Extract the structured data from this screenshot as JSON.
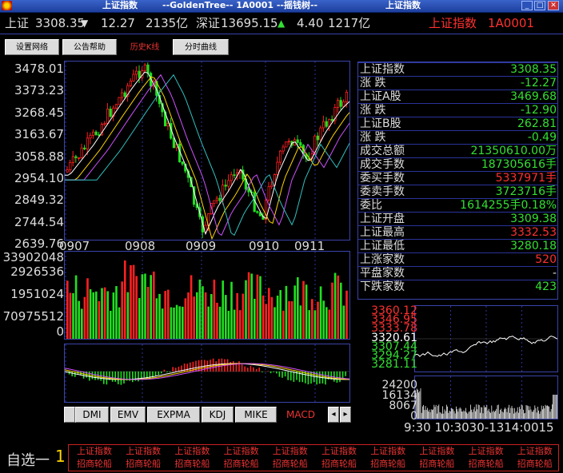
{
  "window": {
    "title_left": "上证指数",
    "title_mid": "--GoldenTree--   1A0001   --摇钱树--",
    "title_right": "上证指数"
  },
  "ticker": {
    "sh_label": "上证",
    "sh_value": "3308.35",
    "sh_change": "12.27",
    "sh_amount": "2135亿",
    "sz_label": "深证",
    "sz_value": "13695.15",
    "sz_change": "4.40",
    "sz_amount": "1217亿",
    "right_name": "上证指数",
    "right_code": "1A0001"
  },
  "tabs": [
    {
      "label": "设置网络"
    },
    {
      "label": "公告帮助"
    },
    {
      "label": "历史K线"
    },
    {
      "label": "分时曲线"
    }
  ],
  "price_axis": [
    "3478.01",
    "3373.23",
    "3268.45",
    "3163.67",
    "3058.88",
    "2954.10",
    "2849.32",
    "2744.54",
    "2639.76"
  ],
  "month_axis": [
    "0907",
    "0908",
    "0909",
    "0910",
    "0911"
  ],
  "volume_axis": [
    "33902048",
    "2926536",
    "1951024",
    "70975512",
    "0"
  ],
  "info": [
    {
      "label": "上证指数",
      "value": "3308.35",
      "color": "#33e033"
    },
    {
      "label": "涨  跌",
      "value": "-12.27",
      "color": "#33e033"
    },
    {
      "label": "上证A股",
      "value": "3469.68",
      "color": "#33e033"
    },
    {
      "label": "涨  跌",
      "value": "-12.90",
      "color": "#33e033"
    },
    {
      "label": "上证B股",
      "value": "262.81",
      "color": "#33e033"
    },
    {
      "label": "涨  跌",
      "value": "-0.49",
      "color": "#33e033"
    },
    {
      "label": "成交总额",
      "value": "21350610.00万",
      "color": "#33e033"
    },
    {
      "label": "成交手数",
      "value": "187305616手",
      "color": "#33e033"
    },
    {
      "label": "委买手数",
      "value": "5337971手",
      "color": "#ff3030"
    },
    {
      "label": "委卖手数",
      "value": "3723716手",
      "color": "#33e033"
    },
    {
      "label": "委比",
      "value": "1614255手0.18%",
      "color": "#33e033"
    },
    {
      "label": "上证开盘",
      "value": "3309.38",
      "color": "#33e033"
    },
    {
      "label": "上证最高",
      "value": "3332.53",
      "color": "#ff3030"
    },
    {
      "label": "上证最低",
      "value": "3280.18",
      "color": "#33e033"
    },
    {
      "label": "上涨家数",
      "value": "520",
      "color": "#ff3030"
    },
    {
      "label": "平盘家数",
      "value": "-",
      "color": "#dddddd"
    },
    {
      "label": "下跌家数",
      "value": "423",
      "color": "#33e033"
    }
  ],
  "intraday_axis": [
    {
      "v": "3360.12",
      "color": "#ff3030"
    },
    {
      "v": "3346.95",
      "color": "#ff3030"
    },
    {
      "v": "3333.78",
      "color": "#ff3030"
    },
    {
      "v": "3320.61",
      "color": "#ffffff"
    },
    {
      "v": "3307.44",
      "color": "#33e033"
    },
    {
      "v": "3294.27",
      "color": "#33e033"
    },
    {
      "v": "3281.11",
      "color": "#33e033"
    }
  ],
  "intraday_vol_axis": [
    "24200",
    "16134",
    "8067",
    "0"
  ],
  "intraday_time_axis": "9:30 10:3030-1314:0015",
  "indicator_tabs": [
    "DMI",
    "EMV",
    "EXPMA",
    "KDJ",
    "MIKE",
    "MACD"
  ],
  "scroll": {
    "left": "◂",
    "right": "▸"
  },
  "watchlist": {
    "label": "自选一",
    "number": "1",
    "cells": [
      {
        "top": "上证指数",
        "bottom": "招商轮船"
      },
      {
        "top": "上证指数",
        "bottom": "招商轮船"
      },
      {
        "top": "上证指数",
        "bottom": "招商轮船"
      },
      {
        "top": "上证指数",
        "bottom": "招商轮船"
      },
      {
        "top": "上证指数",
        "bottom": "招商轮船"
      },
      {
        "top": "上证指数",
        "bottom": "招商轮船"
      },
      {
        "top": "上证指数",
        "bottom": "招商轮船"
      },
      {
        "top": "上证指数",
        "bottom": "招商轮船"
      },
      {
        "top": "上证指数",
        "bottom": "招商轮船"
      },
      {
        "top": "上证指数",
        "bottom": "招商轮船"
      }
    ]
  }
}
